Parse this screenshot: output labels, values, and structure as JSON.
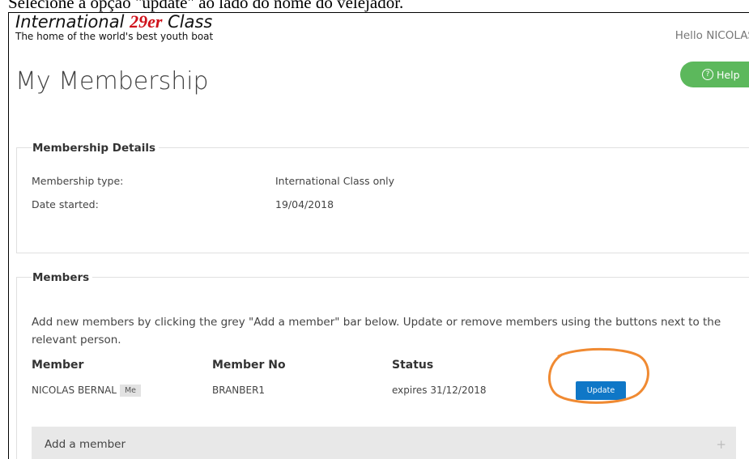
{
  "caption": "Selecione a opção \"update\" ao lado do nome do velejador.",
  "header": {
    "logo_prefix": "International ",
    "logo_number": "29er",
    "logo_suffix": " Class",
    "tagline": "The home of the world's best youth boat",
    "greeting": "Hello NICOLAS",
    "help_label": "Help",
    "help_icon_glyph": "?"
  },
  "page": {
    "title": "My Membership"
  },
  "membership_details": {
    "legend": "Membership Details",
    "rows": [
      {
        "label": "Membership type:",
        "value": "International Class only"
      },
      {
        "label": "Date started:",
        "value": "19/04/2018"
      }
    ]
  },
  "members": {
    "legend": "Members",
    "instructions": "Add new members by clicking the grey \"Add a member\" bar below. Update or remove members using the buttons next to the relevant person.",
    "columns": [
      "Member",
      "Member No",
      "Status"
    ],
    "rows": [
      {
        "name": "NICOLAS BERNAL",
        "badge": "Me",
        "member_no": "BRANBER1",
        "status": "expires 31/12/2018",
        "action_label": "Update"
      }
    ],
    "add_member_label": "Add a member",
    "add_icon_glyph": "+"
  },
  "colors": {
    "help_green": "#5cb85c",
    "update_blue": "#0f77c7",
    "highlight_orange": "#f08a32",
    "logo_red": "#d0121b"
  },
  "icons": {
    "help": "question-circle-icon",
    "add": "plus-icon"
  }
}
